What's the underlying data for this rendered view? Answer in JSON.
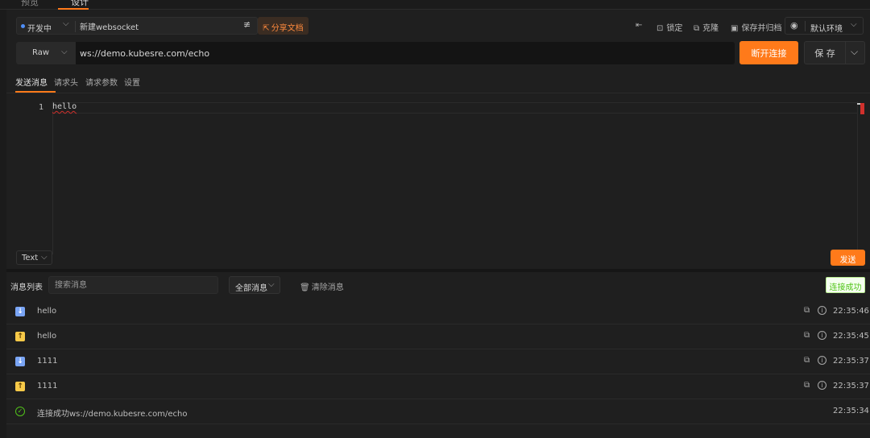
{
  "top_tabs": [
    "预览",
    "设计"
  ],
  "toolbar": {
    "env_status": "开发中",
    "name_value": "新建websocket",
    "share_label": "分享文档",
    "tools": [
      {
        "icon": "menu-collapse-icon",
        "label": ""
      },
      {
        "icon": "lock-icon",
        "label": "锁定"
      },
      {
        "icon": "copy-icon",
        "label": "克隆"
      },
      {
        "icon": "save-archive-icon",
        "label": "保存并归档"
      }
    ],
    "environment": "默认环境"
  },
  "request": {
    "method": "Raw",
    "url": "ws://demo.kubesre.com/echo",
    "disconnect_label": "断开连接",
    "save_label": "保 存"
  },
  "subtabs": [
    "发送消息",
    "请求头",
    "请求参数",
    "设置"
  ],
  "editor": {
    "line_number": "1",
    "content": "hello",
    "format": "Text",
    "send_label": "发送"
  },
  "messages": {
    "title": "消息列表",
    "search_placeholder": "搜索消息",
    "filter": "全部消息",
    "clear_label": "清除消息",
    "status": "连接成功",
    "items": [
      {
        "direction": "in",
        "content": "hello",
        "time": "22:35:46"
      },
      {
        "direction": "out",
        "content": "hello",
        "time": "22:35:45"
      },
      {
        "direction": "in",
        "content": "1111",
        "time": "22:35:37"
      },
      {
        "direction": "out",
        "content": "1111",
        "time": "22:35:37"
      },
      {
        "direction": "ok",
        "content": "连接成功ws://demo.kubesre.com/echo",
        "time": "22:35:34"
      }
    ]
  },
  "colors": {
    "accent": "#ff7a1a",
    "background": "#1f1f1f",
    "success": "#52c41a",
    "incoming": "#7aa5f5",
    "outgoing": "#f7c948"
  }
}
